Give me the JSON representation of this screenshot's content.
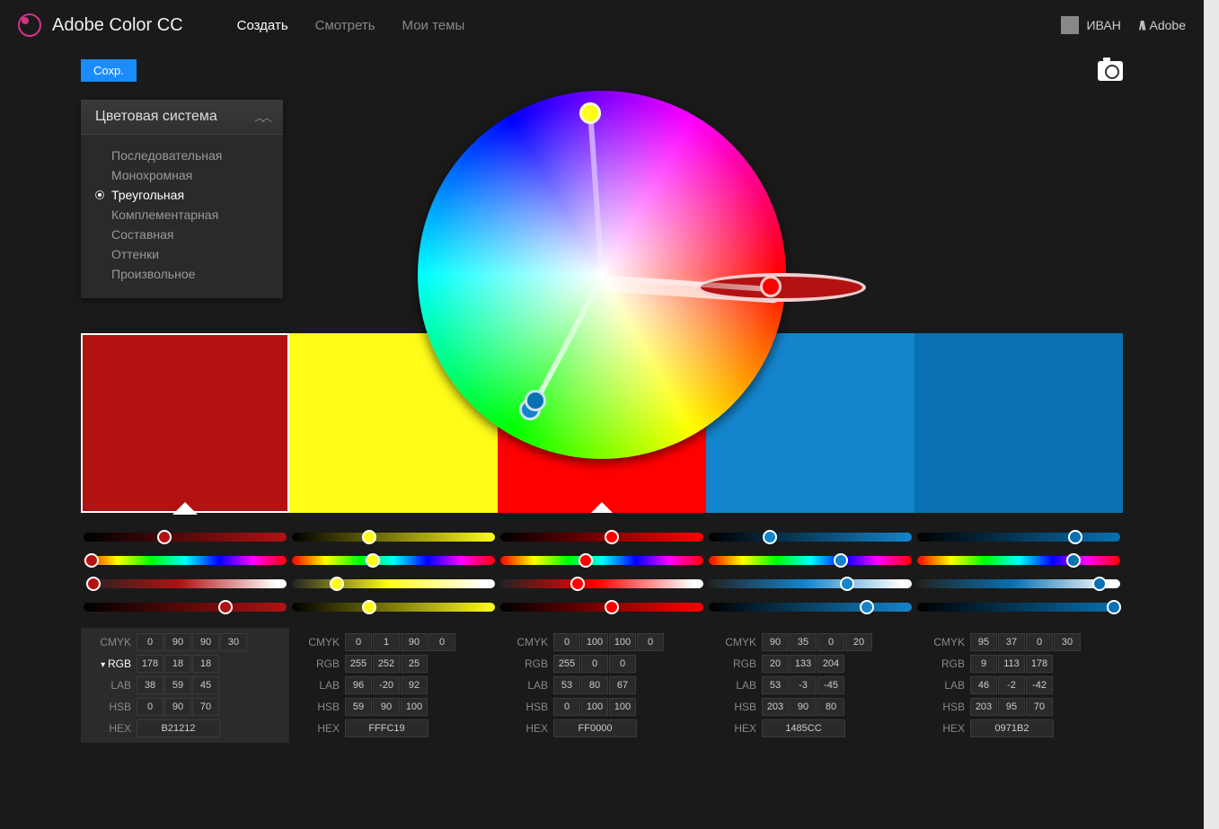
{
  "header": {
    "app_name": "Adobe Color CC",
    "nav": [
      {
        "label": "Создать",
        "active": true
      },
      {
        "label": "Смотреть",
        "active": false
      },
      {
        "label": "Мои темы",
        "active": false
      }
    ],
    "user_name": "ИВАН",
    "adobe_label": "Adobe"
  },
  "toolbar": {
    "save_label": "Сохр."
  },
  "rule_panel": {
    "title": "Цветовая система",
    "items": [
      {
        "label": "Последовательная",
        "selected": false
      },
      {
        "label": "Монохромная",
        "selected": false
      },
      {
        "label": "Треугольная",
        "selected": true
      },
      {
        "label": "Комплементарная",
        "selected": false
      },
      {
        "label": "Составная",
        "selected": false
      },
      {
        "label": "Оттенки",
        "selected": false
      },
      {
        "label": "Произвольное",
        "selected": false
      }
    ]
  },
  "wheel": {
    "points": [
      {
        "angle": -94,
        "radius": 180,
        "color": "#FFFC19",
        "main": false
      },
      {
        "angle": 4,
        "radius": 200,
        "color": "#B21212",
        "main": true
      },
      {
        "angle": 4,
        "radius": 188,
        "color": "#FF0000",
        "main": false
      },
      {
        "angle": 118,
        "radius": 170,
        "color": "#1485CC",
        "main": false
      },
      {
        "angle": 118,
        "radius": 158,
        "color": "#0971B2",
        "main": false
      }
    ]
  },
  "swatches": [
    {
      "hex": "#B21212",
      "active": true
    },
    {
      "hex": "#FFFC19",
      "active": false
    },
    {
      "hex": "#FF0000",
      "active": false,
      "arrow": true
    },
    {
      "hex": "#1485CC",
      "active": false
    },
    {
      "hex": "#0971B2",
      "active": false
    }
  ],
  "sliders": {
    "rows": [
      {
        "type": "grad",
        "handles": [
          40,
          38,
          55,
          30,
          78
        ]
      },
      {
        "type": "hue",
        "handles": [
          4,
          40,
          42,
          65,
          77
        ]
      },
      {
        "type": "sat",
        "handles": [
          5,
          22,
          38,
          68,
          90
        ]
      },
      {
        "type": "end",
        "handles": [
          70,
          38,
          55,
          78,
          97
        ]
      }
    ]
  },
  "value_labels": {
    "cmyk": "CMYK",
    "rgb": "RGB",
    "lab": "LAB",
    "hsb": "HSB",
    "hex": "HEX"
  },
  "columns": [
    {
      "active": true,
      "cmyk": [
        "0",
        "90",
        "90",
        "30"
      ],
      "rgb": [
        "178",
        "18",
        "18"
      ],
      "lab": [
        "38",
        "59",
        "45"
      ],
      "hsb": [
        "0",
        "90",
        "70"
      ],
      "hex": "B21212"
    },
    {
      "active": false,
      "cmyk": [
        "0",
        "1",
        "90",
        "0"
      ],
      "rgb": [
        "255",
        "252",
        "25"
      ],
      "lab": [
        "96",
        "-20",
        "92"
      ],
      "hsb": [
        "59",
        "90",
        "100"
      ],
      "hex": "FFFC19"
    },
    {
      "active": false,
      "cmyk": [
        "0",
        "100",
        "100",
        "0"
      ],
      "rgb": [
        "255",
        "0",
        "0"
      ],
      "lab": [
        "53",
        "80",
        "67"
      ],
      "hsb": [
        "0",
        "100",
        "100"
      ],
      "hex": "FF0000"
    },
    {
      "active": false,
      "cmyk": [
        "90",
        "35",
        "0",
        "20"
      ],
      "rgb": [
        "20",
        "133",
        "204"
      ],
      "lab": [
        "53",
        "-3",
        "-45"
      ],
      "hsb": [
        "203",
        "90",
        "80"
      ],
      "hex": "1485CC"
    },
    {
      "active": false,
      "cmyk": [
        "95",
        "37",
        "0",
        "30"
      ],
      "rgb": [
        "9",
        "113",
        "178"
      ],
      "lab": [
        "46",
        "-2",
        "-42"
      ],
      "hsb": [
        "203",
        "95",
        "70"
      ],
      "hex": "0971B2"
    }
  ]
}
